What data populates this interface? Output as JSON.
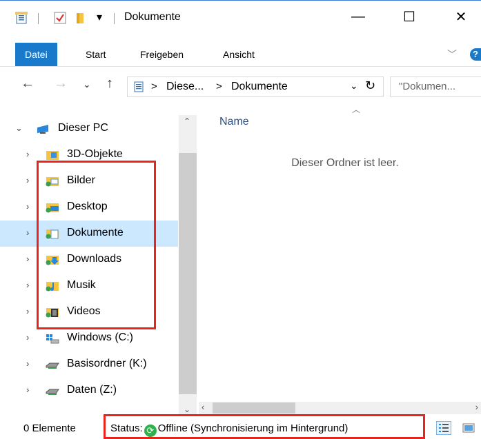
{
  "window": {
    "title": "Dokumente",
    "controls": {
      "minimize": "—",
      "maximize": "☐",
      "close": "✕"
    }
  },
  "ribbon": {
    "tabs": [
      {
        "label": "Datei",
        "active": true
      },
      {
        "label": "Start"
      },
      {
        "label": "Freigeben"
      },
      {
        "label": "Ansicht"
      }
    ],
    "help_label": "?"
  },
  "address": {
    "breadcrumb": [
      "Diese...",
      "Dokumente"
    ],
    "separator": ">",
    "search_placeholder": "\"Dokumen..."
  },
  "nav": {
    "items": [
      {
        "label": "Dieser PC",
        "icon": "pc-icon",
        "expanded": true
      },
      {
        "label": "3D-Objekte",
        "icon": "folder-3d-icon"
      },
      {
        "label": "Bilder",
        "icon": "pictures-folder-icon"
      },
      {
        "label": "Desktop",
        "icon": "desktop-folder-icon"
      },
      {
        "label": "Dokumente",
        "icon": "documents-folder-icon",
        "selected": true
      },
      {
        "label": "Downloads",
        "icon": "downloads-folder-icon"
      },
      {
        "label": "Musik",
        "icon": "music-folder-icon"
      },
      {
        "label": "Videos",
        "icon": "videos-folder-icon"
      },
      {
        "label": "Windows (C:)",
        "icon": "windows-drive-icon"
      },
      {
        "label": "Basisordner (K:)",
        "icon": "network-drive-icon"
      },
      {
        "label": "Daten (Z:)",
        "icon": "network-drive-icon"
      }
    ]
  },
  "content": {
    "column_name": "Name",
    "empty_message": "Dieser Ordner ist leer."
  },
  "status": {
    "count": "0 Elemente",
    "label": "Status:",
    "value": "Offline (Synchronisierung im Hintergrund)"
  },
  "colors": {
    "accent": "#1979ca",
    "highlight": "#e8241b",
    "selected": "#cce8ff"
  }
}
